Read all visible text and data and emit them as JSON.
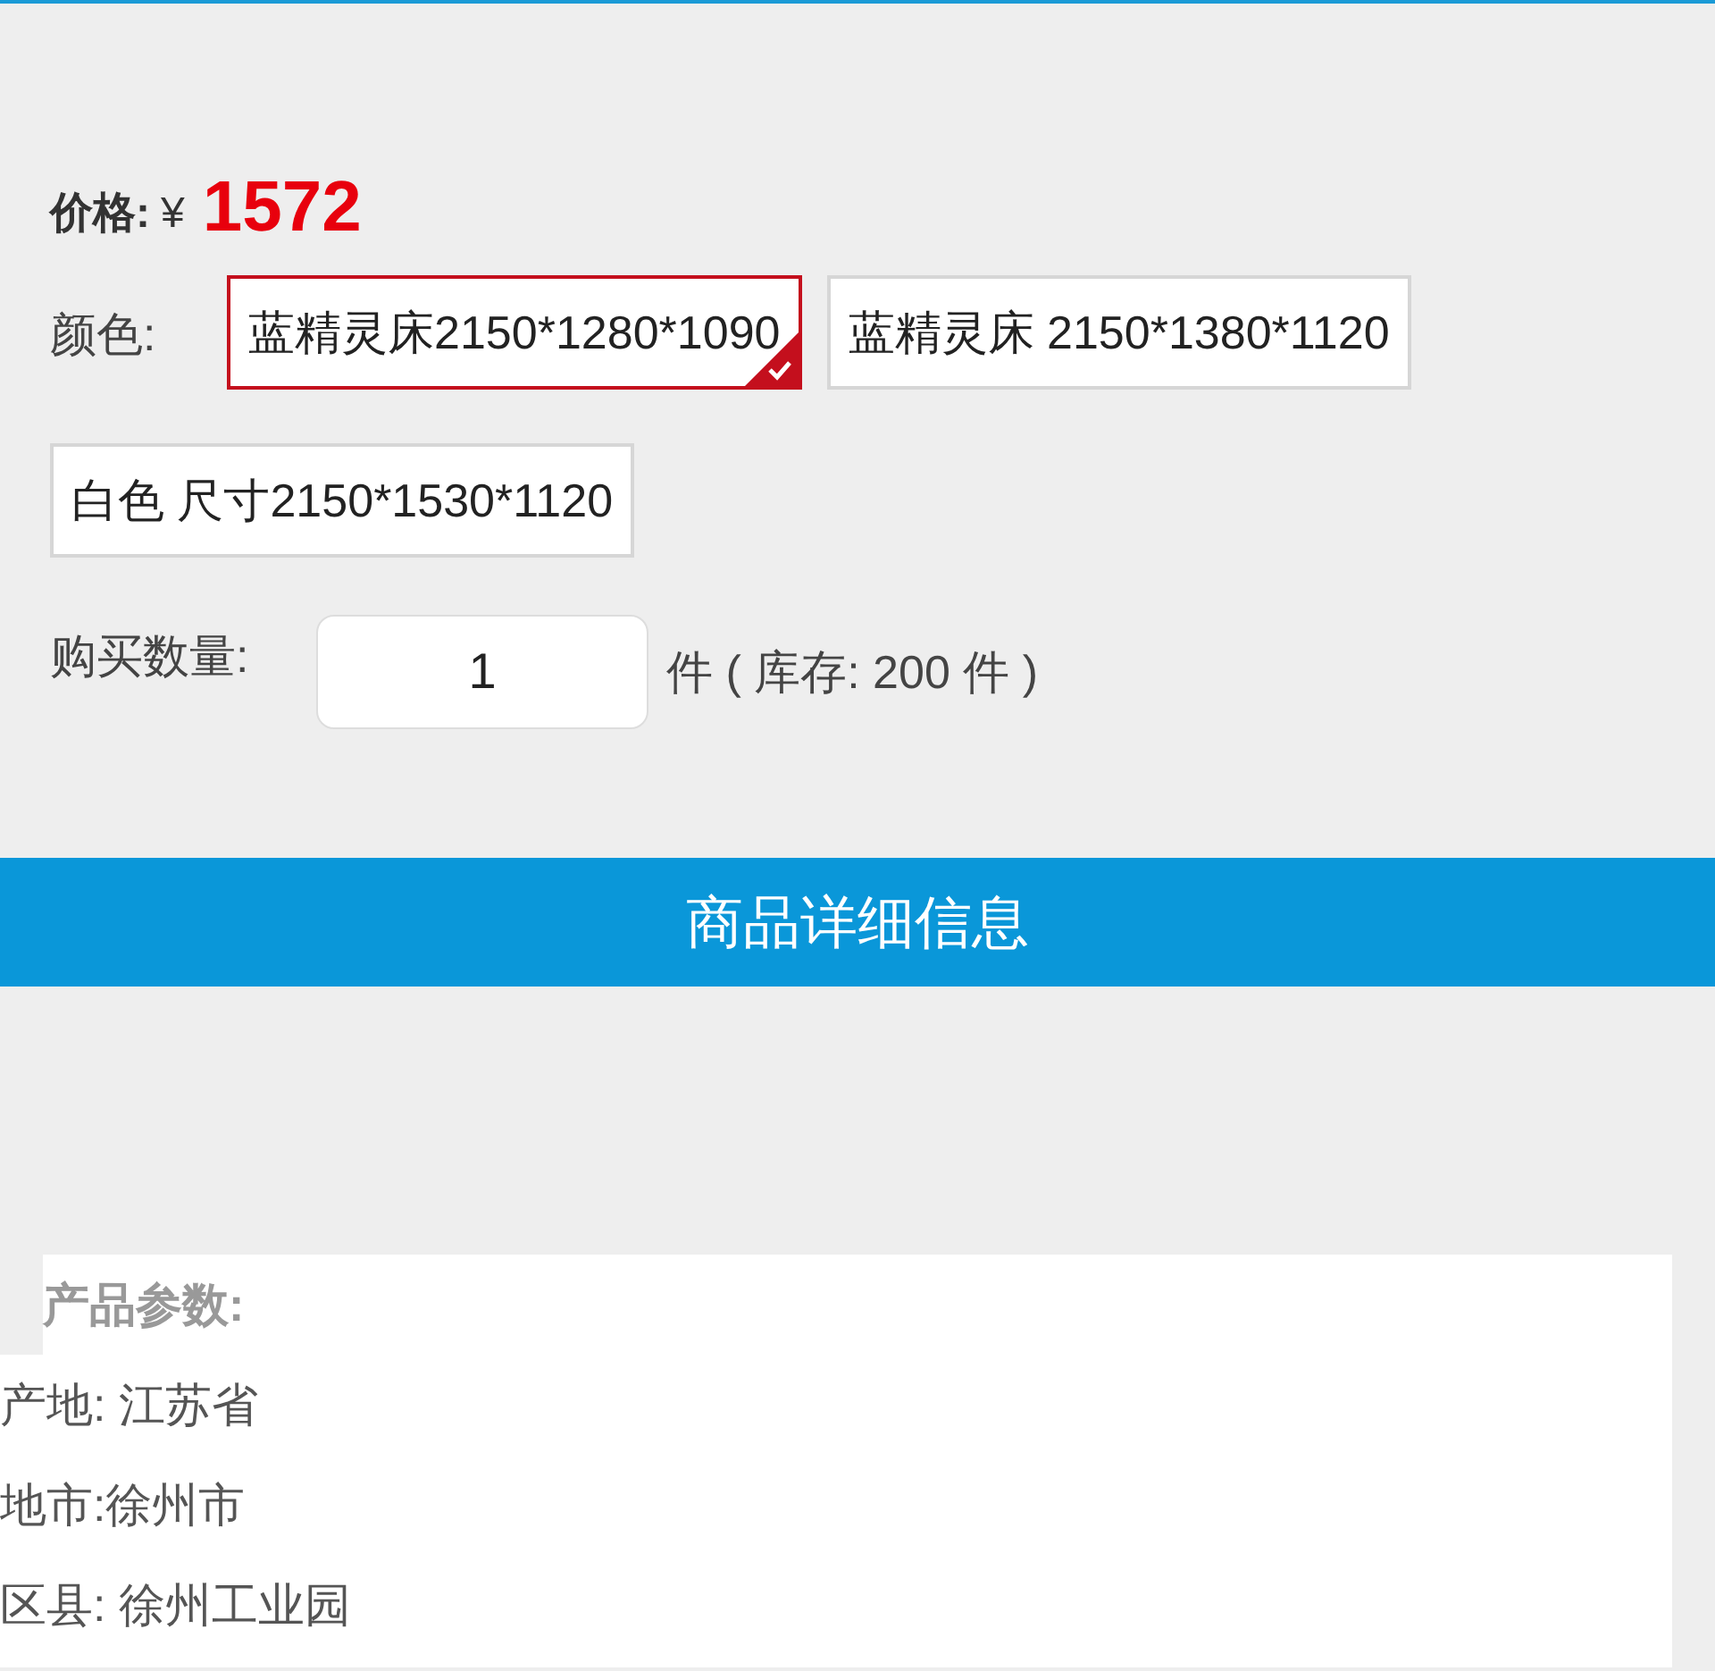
{
  "price": {
    "label": "价格:",
    "currency": "¥",
    "value": "1572"
  },
  "color": {
    "label": "颜色:",
    "options": [
      {
        "label": "蓝精灵床2150*1280*1090",
        "selected": true
      },
      {
        "label": "蓝精灵床 2150*1380*1120",
        "selected": false
      },
      {
        "label": "白色 尺寸2150*1530*1120",
        "selected": false
      }
    ]
  },
  "quantity": {
    "label": "购买数量:",
    "value": "1",
    "unit": "件 ( 库存: 200 件 )"
  },
  "details_bar": {
    "title": "商品详细信息"
  },
  "params": {
    "heading": "产品参数:",
    "lines": [
      "产地: 江苏省",
      "地市:徐州市",
      "区县: 徐州工业园"
    ]
  }
}
